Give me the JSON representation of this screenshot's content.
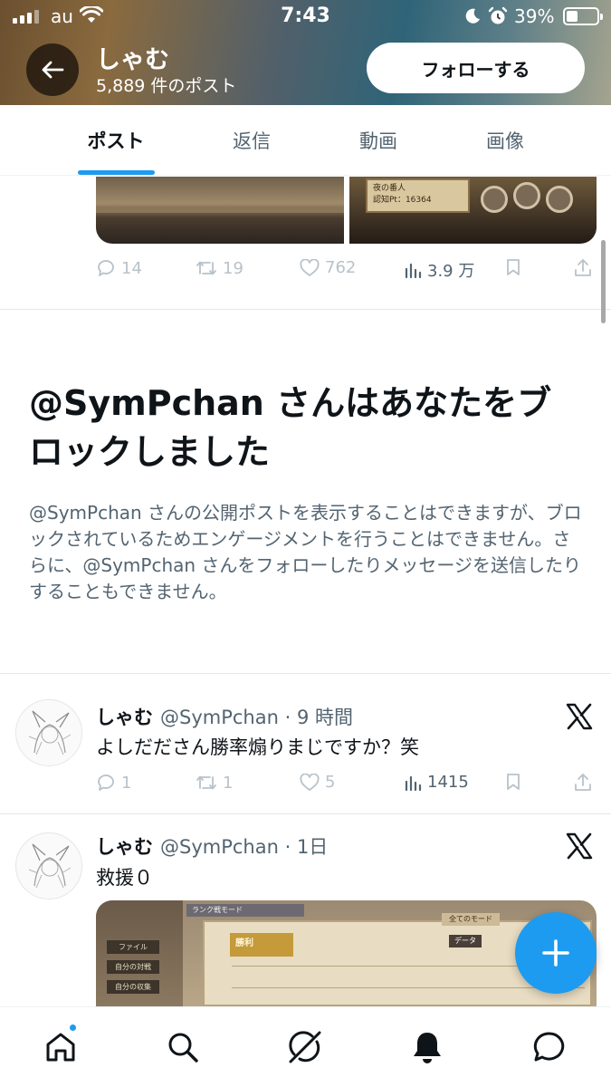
{
  "status_bar": {
    "carrier": "au",
    "time": "7:43",
    "battery_percent": "39%",
    "battery_level": 0.39,
    "icons": [
      "signal-icon",
      "wifi-icon",
      "moon-icon",
      "alarm-icon",
      "battery-icon"
    ]
  },
  "header": {
    "profile_name": "しゃむ",
    "post_count": "5,889 件のポスト",
    "follow_label": "フォローする",
    "back_icon": "arrow-left-icon"
  },
  "tabs": [
    {
      "label": "ポスト",
      "active": true
    },
    {
      "label": "返信",
      "active": false
    },
    {
      "label": "動画",
      "active": false
    },
    {
      "label": "画像",
      "active": false
    }
  ],
  "top_post": {
    "media_card_text": [
      "夜の番人",
      "認知Pt：16364"
    ],
    "metrics": {
      "replies": "14",
      "reposts": "19",
      "likes": "762",
      "views": "3.9 万"
    }
  },
  "block_notice": {
    "title": "@SymPchan さんはあなたをブロックしました",
    "description": "@SymPchan さんの公開ポストを表示することはできますが、ブロックされているためエンゲージメントを行うことはできません。さらに、@SymPchan さんをフォローしたりメッセージを送信したりすることもできません。"
  },
  "tweets": [
    {
      "name": "しゃむ",
      "handle_time": "@SymPchan · 9 時間",
      "text": "よしだださん勝率煽りまじですか？笑",
      "metrics": {
        "replies": "1",
        "reposts": "1",
        "likes": "5",
        "views": "1415"
      }
    },
    {
      "name": "しゃむ",
      "handle_time": "@SymPchan · 1日",
      "text": "救援０",
      "media": {
        "sidebar_buttons": [
          "ファイル",
          "自分の対戦",
          "自分の収集"
        ],
        "tab_label": "ランク戦モード",
        "result_label": "勝利",
        "mode_label": "全てのモード",
        "data_label": "データ"
      }
    }
  ],
  "colors": {
    "accent": "#1d9bf0",
    "text": "#0f1419",
    "muted": "#536471",
    "faint_icon": "#b8c2c9"
  },
  "bottom_nav": [
    {
      "name": "home-icon",
      "has_badge": true
    },
    {
      "name": "search-icon"
    },
    {
      "name": "grok-icon"
    },
    {
      "name": "notifications-bell-icon"
    },
    {
      "name": "messages-icon"
    }
  ]
}
